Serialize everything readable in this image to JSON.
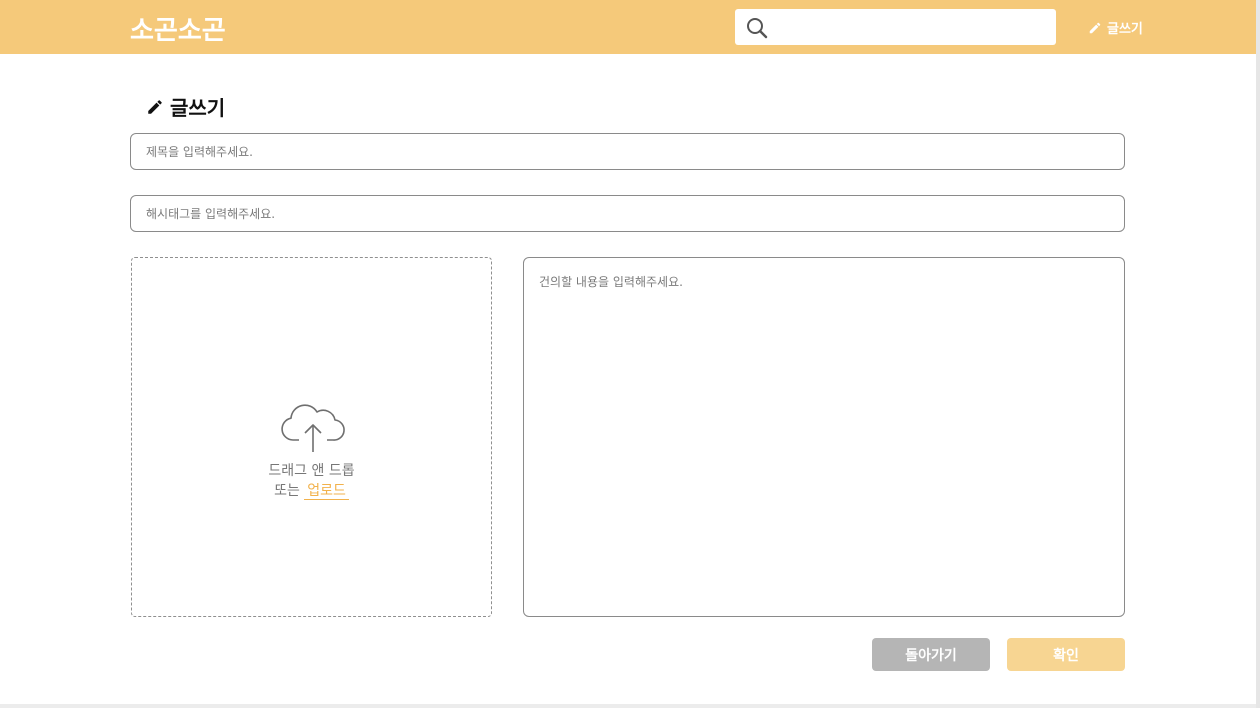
{
  "header": {
    "logo": "소곤소곤",
    "search_placeholder": "",
    "search_icon": "search-icon",
    "write_label": "글쓰기",
    "write_icon": "pencil-icon"
  },
  "page": {
    "title": "글쓰기",
    "title_icon": "pencil-icon"
  },
  "form": {
    "title_placeholder": "제목을 입력해주세요.",
    "hashtag_placeholder": "해시태그를 입력해주세요.",
    "content_placeholder": "건의할 내용을 입력해주세요.",
    "upload": {
      "icon": "cloud-upload-icon",
      "line1": "드래그 앤 드롭",
      "line2_prefix": "또는",
      "link": "업로드"
    }
  },
  "buttons": {
    "back": "돌아가기",
    "confirm": "확인"
  },
  "colors": {
    "header_bg": "#f5c97a",
    "accent": "#f2b24c",
    "back_button": "#b5b5b5",
    "confirm_button": "#f7d592"
  }
}
